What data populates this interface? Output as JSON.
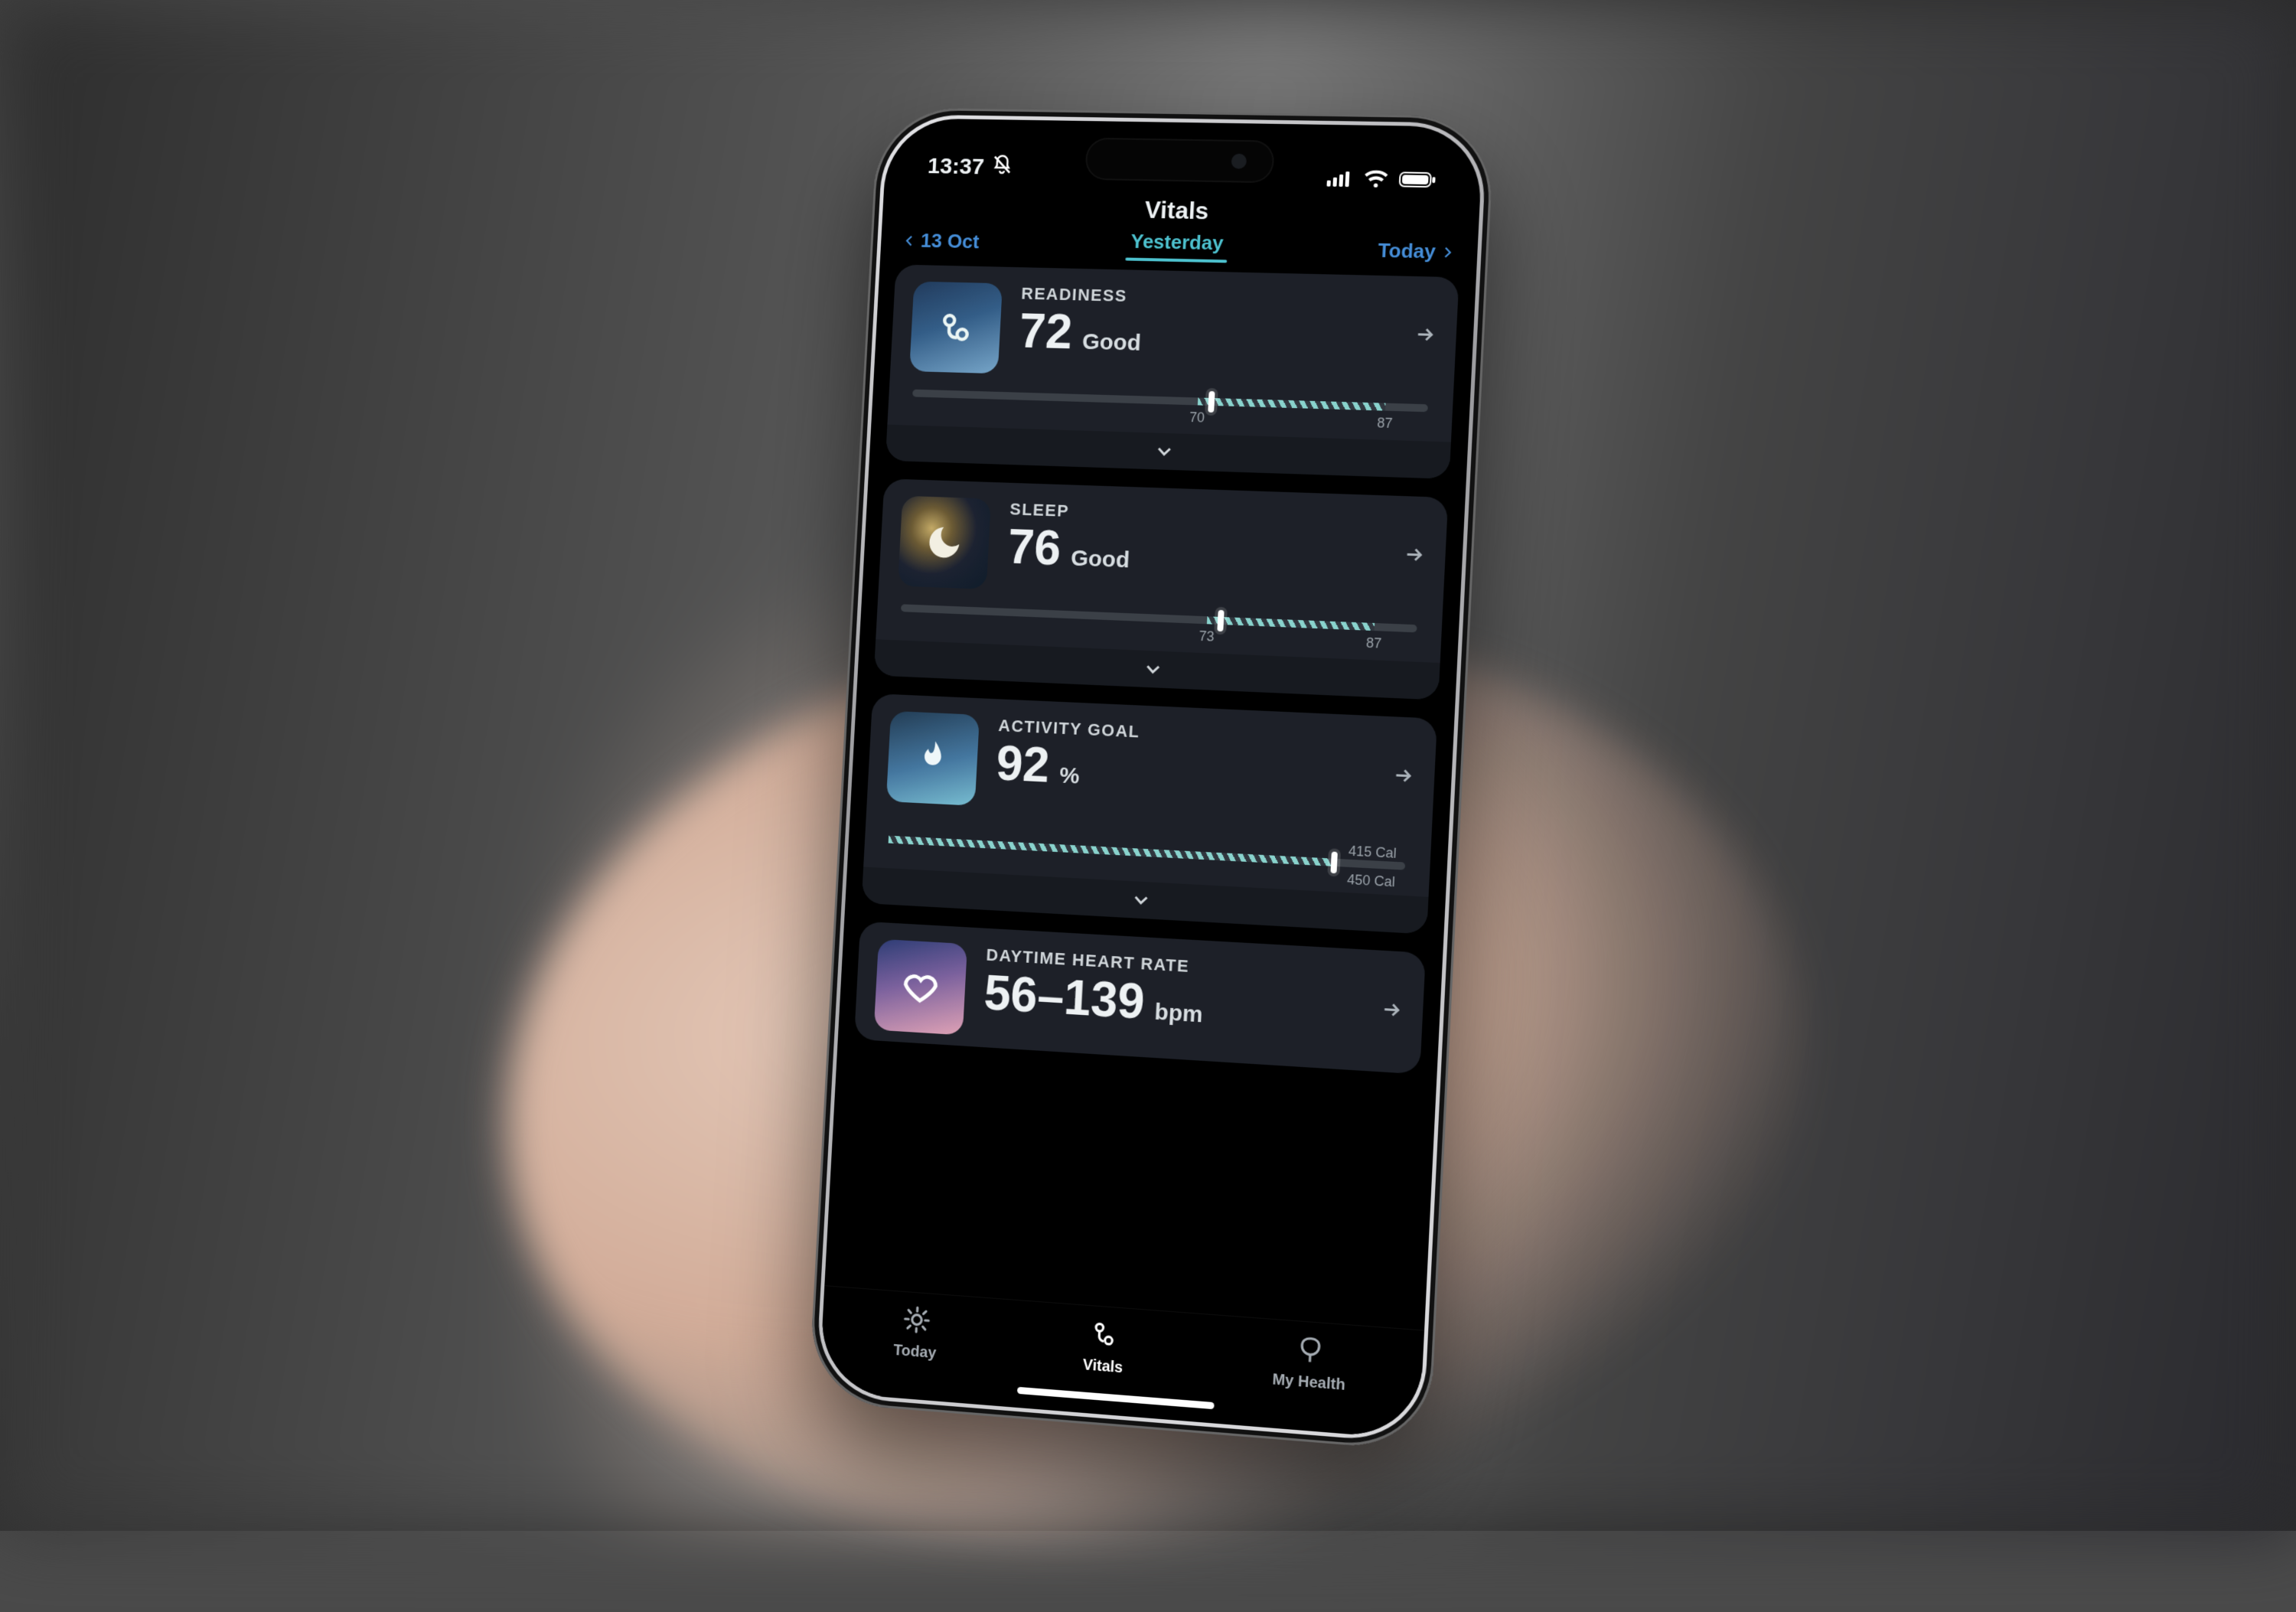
{
  "statusbar": {
    "time": "13:37",
    "dnd_icon": "bell-slash-icon"
  },
  "header": {
    "title": "Vitals"
  },
  "daytabs": {
    "prev": "13 Oct",
    "current": "Yesterday",
    "next": "Today"
  },
  "cards": {
    "readiness": {
      "label": "READINESS",
      "value": "72",
      "unit": "Good",
      "range_lo": "70",
      "range_hi": "87",
      "range_lo_pct": 56,
      "range_hi_pct": 92,
      "marker_pct": 58
    },
    "sleep": {
      "label": "SLEEP",
      "value": "76",
      "unit": "Good",
      "range_lo": "73",
      "range_hi": "87",
      "range_lo_pct": 60,
      "range_hi_pct": 92,
      "marker_pct": 62
    },
    "activity": {
      "label": "ACTIVITY GOAL",
      "value": "92",
      "unit": "%",
      "current_cal": "415 Cal",
      "goal_cal": "450 Cal",
      "marker_pct": 86
    },
    "heartrate": {
      "label": "DAYTIME HEART RATE",
      "value": "56–139",
      "unit": "bpm"
    }
  },
  "tabs": {
    "today": "Today",
    "vitals": "Vitals",
    "myhealth": "My Health"
  }
}
